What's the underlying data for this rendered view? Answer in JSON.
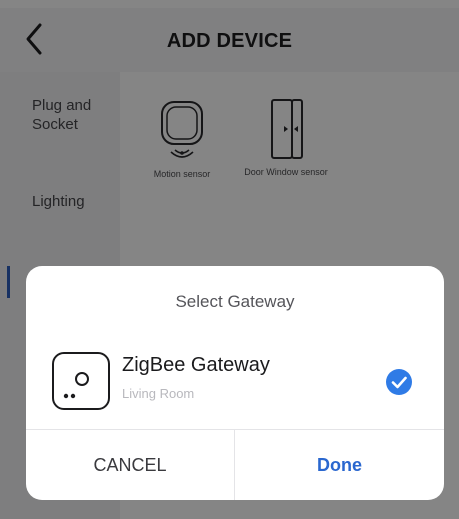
{
  "header": {
    "title": "ADD DEVICE",
    "back_icon": "chevron-left-icon"
  },
  "sidebar": {
    "items": [
      {
        "label": "Plug and\nSocket"
      },
      {
        "label": "Lighting"
      }
    ]
  },
  "devices": [
    {
      "label": "Motion sensor",
      "icon": "motion-sensor-icon"
    },
    {
      "label": "Door Window sensor",
      "icon": "door-window-sensor-icon"
    }
  ],
  "dialog": {
    "title": "Select Gateway",
    "gateway": {
      "name": "ZigBee Gateway",
      "room": "Living Room",
      "icon": "gateway-icon",
      "selected": true
    },
    "cancel_label": "CANCEL",
    "done_label": "Done"
  },
  "colors": {
    "accent": "#2a67cf",
    "check": "#2f7be6",
    "overlay": "rgba(0,0,0,0.48)"
  }
}
